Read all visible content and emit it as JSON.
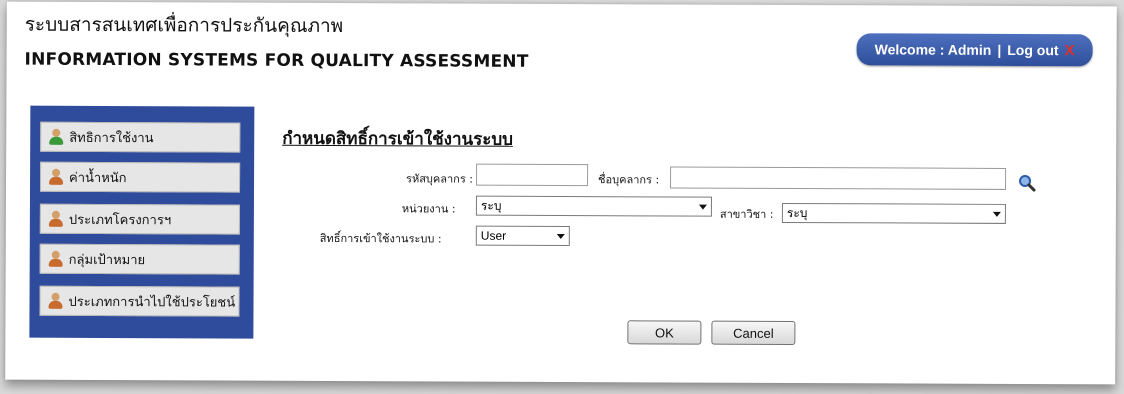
{
  "header": {
    "title_th": "ระบบสารสนเทศเพื่อการประกันคุณภาพ",
    "title_en": "INFORMATION SYSTEMS FOR QUALITY ASSESSMENT"
  },
  "welcome": {
    "text": "Welcome : Admin",
    "separator": "|",
    "logout": "Log out",
    "logout_icon": "X"
  },
  "sidebar": {
    "items": [
      {
        "label": "สิทธิการใช้งาน",
        "icon": "user-green-icon"
      },
      {
        "label": "ค่าน้ำหนัก",
        "icon": "user-orange-icon"
      },
      {
        "label": "ประเภทโครงการฯ",
        "icon": "user-orange-icon"
      },
      {
        "label": "กลุ่มเป้าหมาย",
        "icon": "user-orange-icon"
      },
      {
        "label": "ประเภทการนำไปใช้ประโยชน์",
        "icon": "user-orange-icon"
      }
    ]
  },
  "form": {
    "heading": "กำหนดสิทธิ์การเข้าใช้งานระบบ",
    "staff_id_label": "รหัสบุคลากร :",
    "staff_id_value": "",
    "staff_name_label": "ชื่อบุคลากร :",
    "staff_name_value": "",
    "unit_label": "หน่วยงาน :",
    "unit_value": "ระบุ",
    "branch_label": "สาขาวิชา :",
    "branch_value": "ระบุ",
    "access_label": "สิทธิ์การเข้าใช้งานระบบ :",
    "access_value": "User",
    "ok_label": "OK",
    "cancel_label": "Cancel"
  },
  "colors": {
    "sidebar_bg": "#2f4b9b",
    "welcome_bg": "#3a5aa8",
    "logout_x": "#e0302a"
  }
}
